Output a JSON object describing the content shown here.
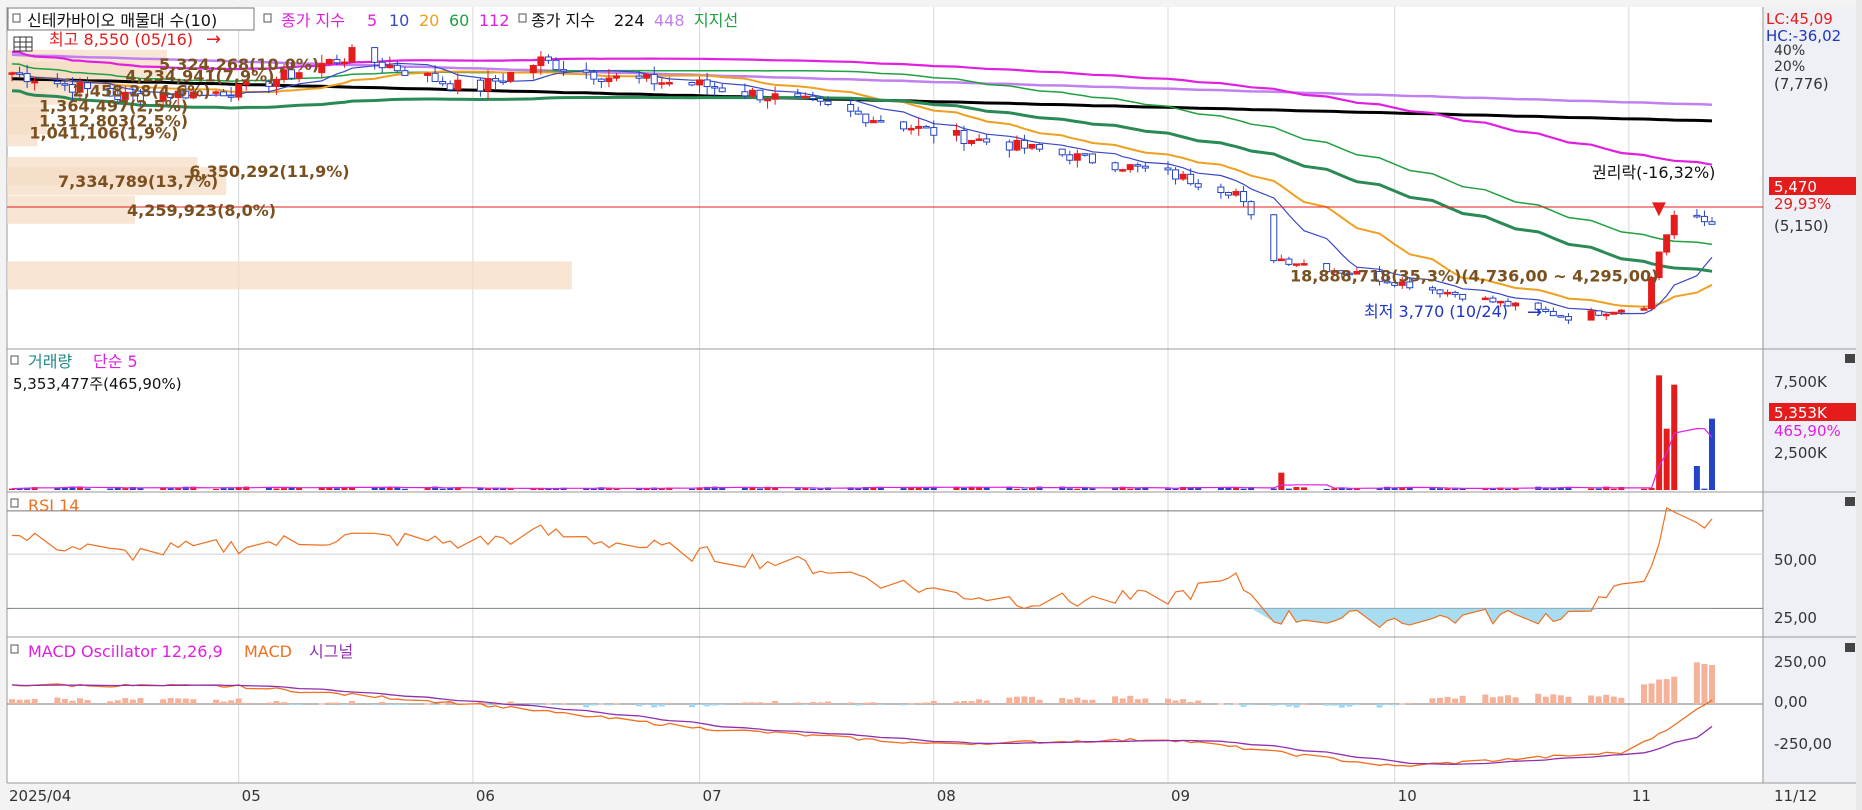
{
  "header": {
    "title": "신테카바이오 매물대 수(10)",
    "close_ma_label": "종가 지수",
    "ma_short": [
      {
        "label": "5",
        "color": "#e020e0"
      },
      {
        "label": "10",
        "color": "#3a48c8"
      },
      {
        "label": "20",
        "color": "#f0a020"
      },
      {
        "label": "60",
        "color": "#20a040"
      },
      {
        "label": "112",
        "color": "#e020e0"
      }
    ],
    "close_ma_label2": "종가 지수",
    "ma_long": [
      {
        "label": "224",
        "color": "#000000"
      },
      {
        "label": "448",
        "color": "#c080f0"
      }
    ],
    "support_label": "지지선"
  },
  "right_info": {
    "lc": "LC:45,09",
    "hc": "HC:-36,02"
  },
  "price_axis": {
    "pct_ticks": [
      "40%",
      "20%"
    ],
    "top_value": "(7,776)",
    "current_price": "5,470",
    "current_pct": "29,93%",
    "ref_value": "(5,150)"
  },
  "annotations": {
    "high": "최고 8,550 (05/16)",
    "low": "최저 3,770 (10/24)",
    "rights": "권리락(-16,32%)"
  },
  "volume_profile": [
    {
      "label": "6,350,292(11,9%)",
      "frac": 0.119
    },
    {
      "label": "7,334,789(13,7%)",
      "frac": 0.137
    },
    {
      "label": "18,888,718(35,3%)(4,736,00 ~ 4,295,00)",
      "frac": 0.353
    },
    {
      "label": "4,259,923(8,0%)",
      "frac": 0.08
    },
    {
      "label": "1,041,106(1,9%)",
      "frac": 0.019
    },
    {
      "label": "1,312,803(2,5%)",
      "frac": 0.025
    },
    {
      "label": "1,364,497(2,5%)",
      "frac": 0.025
    },
    {
      "label": "2,458,28(4,6%)",
      "frac": 0.046
    },
    {
      "label": "4,234,941(7,9%)",
      "frac": 0.079
    },
    {
      "label": "5,324,268(10,0%)",
      "frac": 0.1
    }
  ],
  "volume_panel": {
    "title": "거래량",
    "ma_label": "단순 5",
    "info": "5,353,477주(465,90%)",
    "ticks": [
      "7,500K",
      "2,500K"
    ],
    "current": "5,353K",
    "current_pct": "465,90%"
  },
  "rsi_panel": {
    "title": "RSI 14",
    "ticks": [
      "50,00",
      "25,00"
    ]
  },
  "macd_panel": {
    "title": "MACD Oscillator 12,26,9",
    "macd_label": "MACD",
    "signal_label": "시그널",
    "ticks": [
      "250,00",
      "0,00",
      "-250,00"
    ]
  },
  "x_axis": {
    "labels": [
      "2025/04",
      "05",
      "06",
      "07",
      "08",
      "09",
      "10",
      "11"
    ],
    "end_label": "11/12"
  },
  "colors": {
    "up": "#e51c1c",
    "down": "#2343c8",
    "rsi": "#f07020",
    "macd": "#f07020",
    "signal": "#9030b0",
    "osc_pos": "#f5b29a",
    "osc_neg": "#9fd8f0"
  },
  "chart_data": {
    "type": "candlestick",
    "title": "신테카바이오",
    "x_start": "2025/04",
    "x_end": "2025/11/12",
    "price_range": [
      3600,
      8800
    ],
    "price_keypoints": [
      [
        "2025-04-01",
        8000
      ],
      [
        "2025-04-15",
        7600
      ],
      [
        "2025-05-01",
        7700
      ],
      [
        "2025-05-16",
        8300
      ],
      [
        "2025-06-01",
        7700
      ],
      [
        "2025-06-10",
        8200
      ],
      [
        "2025-06-20",
        7900
      ],
      [
        "2025-07-01",
        7800
      ],
      [
        "2025-07-15",
        7500
      ],
      [
        "2025-08-01",
        7000
      ],
      [
        "2025-08-15",
        6700
      ],
      [
        "2025-09-01",
        6300
      ],
      [
        "2025-09-10",
        6000
      ],
      [
        "2025-09-15",
        4900
      ],
      [
        "2025-10-01",
        4500
      ],
      [
        "2025-10-24",
        3900
      ],
      [
        "2025-11-03",
        4100
      ],
      [
        "2025-11-05",
        5000
      ],
      [
        "2025-11-07",
        5600
      ],
      [
        "2025-11-12",
        5470
      ]
    ],
    "high": 8550,
    "high_date": "05/16",
    "low": 3770,
    "low_date": "10/24",
    "last_close": 5470,
    "volume_last": 5353477,
    "volume_ticks_k": [
      2500,
      7500
    ],
    "volume_spikes_k": [
      [
        "2025-09-16",
        1300
      ],
      [
        "2025-11-05",
        8600
      ],
      [
        "2025-11-06",
        4600
      ],
      [
        "2025-11-07",
        7900
      ],
      [
        "2025-11-10",
        1800
      ],
      [
        "2025-11-12",
        5353
      ]
    ],
    "rsi_keypoints": [
      [
        "2025-04-01",
        58
      ],
      [
        "2025-04-15",
        50
      ],
      [
        "2025-05-01",
        54
      ],
      [
        "2025-05-16",
        58
      ],
      [
        "2025-06-01",
        55
      ],
      [
        "2025-06-10",
        60
      ],
      [
        "2025-07-01",
        50
      ],
      [
        "2025-07-15",
        45
      ],
      [
        "2025-08-01",
        33
      ],
      [
        "2025-08-15",
        28
      ],
      [
        "2025-09-01",
        30
      ],
      [
        "2025-09-10",
        38
      ],
      [
        "2025-09-15",
        21
      ],
      [
        "2025-10-01",
        20
      ],
      [
        "2025-10-24",
        22
      ],
      [
        "2025-11-03",
        38
      ],
      [
        "2025-11-06",
        68
      ],
      [
        "2025-11-10",
        62
      ],
      [
        "2025-11-12",
        64
      ]
    ],
    "rsi_ticks": [
      25,
      50
    ],
    "macd_keypoints": [
      [
        "2025-04-01",
        120
      ],
      [
        "2025-05-01",
        110
      ],
      [
        "2025-06-01",
        0
      ],
      [
        "2025-07-01",
        -150
      ],
      [
        "2025-08-01",
        -250
      ],
      [
        "2025-09-01",
        -220
      ],
      [
        "2025-10-01",
        -390
      ],
      [
        "2025-11-01",
        -300
      ],
      [
        "2025-11-12",
        20
      ]
    ],
    "macd_ticks": [
      -250,
      0,
      250
    ]
  }
}
